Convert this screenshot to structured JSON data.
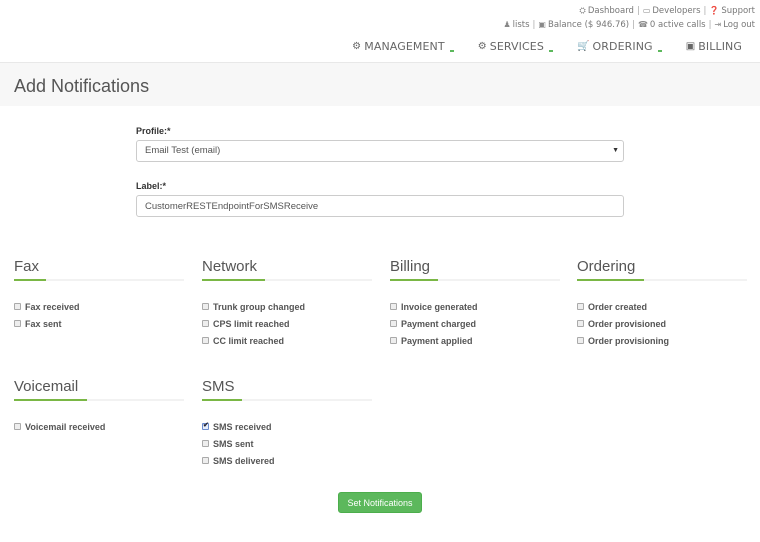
{
  "top_links": {
    "row1": [
      {
        "icon": "dashboard-icon",
        "glyph": "⛭",
        "label": "Dashboard"
      },
      {
        "icon": "developers-icon",
        "glyph": "▭",
        "label": "Developers"
      },
      {
        "icon": "support-icon",
        "glyph": "❓",
        "label": "Support"
      }
    ],
    "row2": [
      {
        "icon": "user-icon",
        "glyph": "♟",
        "label": "lists"
      },
      {
        "icon": "balance-icon",
        "glyph": "▣",
        "label": "Balance ($ 946.76)"
      },
      {
        "icon": "phone-icon",
        "glyph": "☎",
        "label": "0 active calls"
      },
      {
        "icon": "logout-icon",
        "glyph": "⇥",
        "label": "Log out"
      }
    ]
  },
  "main_nav": [
    {
      "icon": "management-icon",
      "glyph": "⚙",
      "label": "MANAGEMENT",
      "dropdown": true
    },
    {
      "icon": "services-icon",
      "glyph": "⚙",
      "label": "SERVICES",
      "dropdown": true
    },
    {
      "icon": "cart-icon",
      "glyph": "🛒",
      "label": "ORDERING",
      "dropdown": true
    },
    {
      "icon": "billing-icon",
      "glyph": "▣",
      "label": "BILLING",
      "dropdown": false
    }
  ],
  "page": {
    "title": "Add Notifications"
  },
  "form": {
    "profile_label": "Profile:*",
    "profile_value": "Email Test (email)",
    "label_label": "Label:*",
    "label_value": "CustomerRESTEndpointForSMSReceive"
  },
  "sections": [
    {
      "title": "Fax",
      "items": [
        {
          "label": "Fax received",
          "checked": false
        },
        {
          "label": "Fax sent",
          "checked": false
        }
      ]
    },
    {
      "title": "Network",
      "items": [
        {
          "label": "Trunk group changed",
          "checked": false
        },
        {
          "label": "CPS limit reached",
          "checked": false
        },
        {
          "label": "CC limit reached",
          "checked": false
        }
      ]
    },
    {
      "title": "Billing",
      "items": [
        {
          "label": "Invoice generated",
          "checked": false
        },
        {
          "label": "Payment charged",
          "checked": false
        },
        {
          "label": "Payment applied",
          "checked": false
        }
      ]
    },
    {
      "title": "Ordering",
      "items": [
        {
          "label": "Order created",
          "checked": false
        },
        {
          "label": "Order provisioned",
          "checked": false
        },
        {
          "label": "Order provisioning",
          "checked": false
        }
      ]
    },
    {
      "title": "Voicemail",
      "items": [
        {
          "label": "Voicemail received",
          "checked": false
        }
      ]
    },
    {
      "title": "SMS",
      "items": [
        {
          "label": "SMS received",
          "checked": true
        },
        {
          "label": "SMS sent",
          "checked": false
        },
        {
          "label": "SMS delivered",
          "checked": false
        }
      ]
    }
  ],
  "submit_label": "Set Notifications",
  "colors": {
    "accent": "#7ab745",
    "button": "#5cb85c"
  }
}
